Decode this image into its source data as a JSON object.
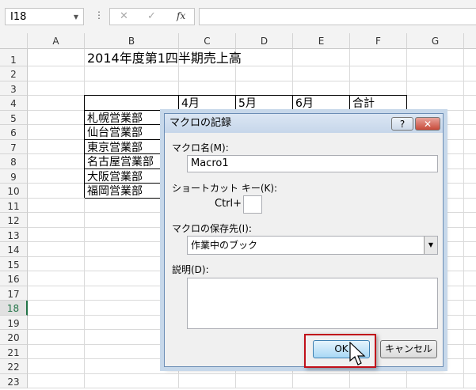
{
  "formula_bar": {
    "name_box": "I18",
    "cancel": "✕",
    "enter": "✓",
    "fx": "fx",
    "formula": ""
  },
  "columns": [
    "A",
    "B",
    "C",
    "D",
    "E",
    "F",
    "G"
  ],
  "rows": [
    "1",
    "2",
    "3",
    "4",
    "5",
    "6",
    "7",
    "8",
    "9",
    "10",
    "11",
    "12",
    "13",
    "14",
    "15",
    "16",
    "17",
    "18",
    "19",
    "20",
    "21",
    "22",
    "23"
  ],
  "selected_row": "18",
  "cells": {
    "title": "2014年度第1四半期売上高",
    "headers": [
      "4月",
      "5月",
      "6月",
      "合計"
    ],
    "branches": [
      "札幌営業部",
      "仙台営業部",
      "東京営業部",
      "名古屋営業部",
      "大阪営業部",
      "福岡営業部"
    ]
  },
  "dialog": {
    "title": "マクロの記録",
    "help": "?",
    "close": "✕",
    "macro_name_label": "マクロ名(M):",
    "macro_name_value": "Macro1",
    "shortcut_label": "ショートカット キー(K):",
    "ctrl_label": "Ctrl+",
    "shortcut_value": "",
    "store_label": "マクロの保存先(I):",
    "store_value": "作業中のブック",
    "description_label": "説明(D):",
    "description_value": "",
    "ok": "OK",
    "cancel": "キャンセル"
  }
}
